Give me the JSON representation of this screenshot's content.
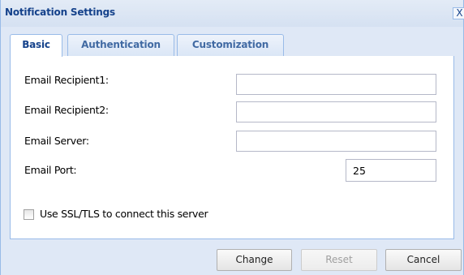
{
  "dialog": {
    "title": "Notification Settings",
    "close_glyph": "X",
    "close_icon": "close-icon"
  },
  "tabs": [
    {
      "label": "Basic",
      "active": true
    },
    {
      "label": "Authentication",
      "active": false
    },
    {
      "label": "Customization",
      "active": false
    }
  ],
  "form": {
    "email_recipient1": {
      "label": "Email Recipient1:",
      "value": ""
    },
    "email_recipient2": {
      "label": "Email Recipient2:",
      "value": ""
    },
    "email_server": {
      "label": "Email Server:",
      "value": ""
    },
    "email_port": {
      "label": "Email Port:",
      "value": "25"
    },
    "ssl": {
      "label": "Use SSL/TLS to connect this server",
      "checked": false
    }
  },
  "buttons": {
    "change": "Change",
    "reset": "Reset",
    "cancel": "Cancel"
  },
  "colors": {
    "title_text": "#15428b",
    "border": "#99bbe8",
    "window_bg": "#dfe8f6"
  }
}
